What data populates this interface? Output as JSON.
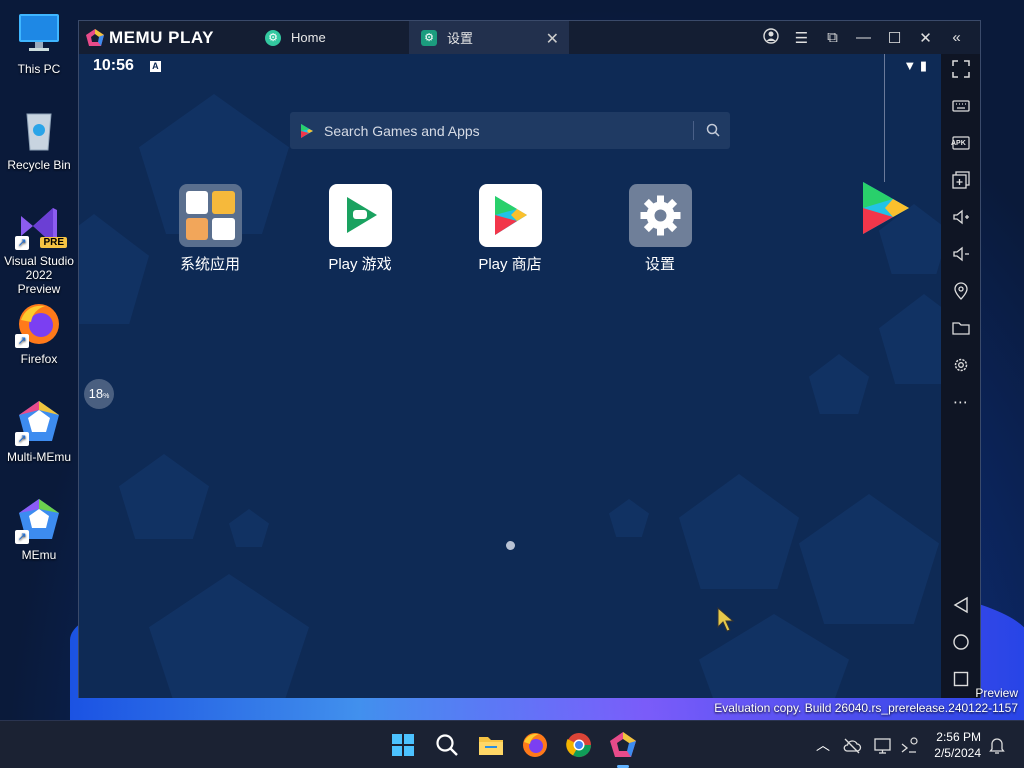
{
  "desktop": {
    "icons": [
      {
        "label": "This PC"
      },
      {
        "label": "Recycle Bin"
      },
      {
        "label": "Visual Studio 2022 Preview",
        "badge": "PRE"
      },
      {
        "label": "Firefox"
      },
      {
        "label": "Multi-MEmu"
      },
      {
        "label": "MEmu"
      }
    ],
    "watermark": {
      "line1": "Preview",
      "line2": "Evaluation copy. Build 26040.rs_prerelease.240122-1157"
    }
  },
  "emulator": {
    "brand": "MEMU PLAY",
    "tabs": [
      {
        "label": "Home",
        "icon": "memu-home-icon"
      },
      {
        "label": "设置",
        "icon": "settings-app-icon",
        "active": true
      }
    ],
    "window_controls": [
      "account-icon",
      "menu-icon",
      "screen-share-icon",
      "minimize-icon",
      "maximize-icon",
      "close-icon",
      "collapse-icon"
    ],
    "screen": {
      "time": "10:56",
      "search_placeholder": "Search Games and Apps",
      "apps": [
        {
          "label": "系统应用",
          "icon": "system-apps-folder-icon"
        },
        {
          "label": "Play 游戏",
          "icon": "play-games-icon"
        },
        {
          "label": "Play 商店",
          "icon": "play-store-icon"
        },
        {
          "label": "设置",
          "icon": "settings-gear-icon"
        }
      ],
      "progress_percent": 18,
      "progress_value": "18",
      "progress_unit": "%"
    },
    "toolbar": [
      "fullscreen-icon",
      "keyboard-icon",
      "apk-icon",
      "add-window-icon",
      "volume-up-icon",
      "volume-down-icon",
      "location-icon",
      "folder-icon",
      "settings-icon",
      "more-icon",
      "back-icon",
      "home-icon",
      "recents-icon"
    ],
    "toolbar_apk_label": "APK"
  },
  "taskbar": {
    "apps": [
      "start-icon",
      "search-icon",
      "file-explorer-icon",
      "firefox-icon",
      "chrome-icon",
      "memu-icon"
    ],
    "tray": [
      "chevron-up-icon",
      "cloud-icon",
      "display-icon",
      "network-icon"
    ],
    "time": "2:56 PM",
    "date": "2/5/2024"
  },
  "colors": {
    "accent": "#1b9c7e",
    "taskbar": "#1b2233",
    "screen": "#0e2a55"
  }
}
